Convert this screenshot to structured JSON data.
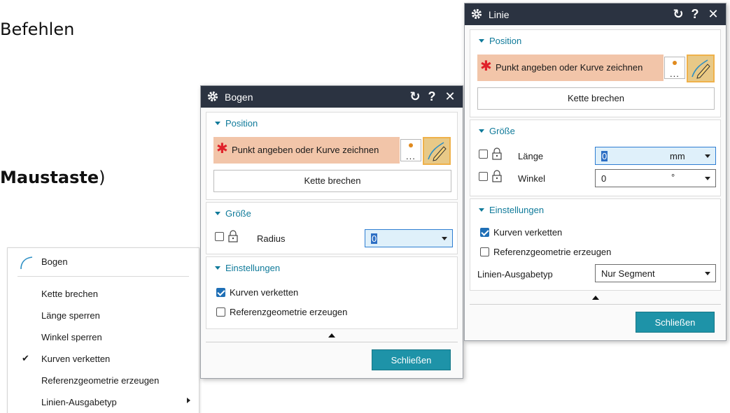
{
  "background": {
    "line1": "Befehlen",
    "line2_bold": "Maustaste",
    "line2_paren": ")"
  },
  "context_menu": {
    "header": "Bogen",
    "items": [
      {
        "label": "Kette brechen",
        "checked": false,
        "submenu": false
      },
      {
        "label": "Länge sperren",
        "checked": false,
        "submenu": false
      },
      {
        "label": "Winkel sperren",
        "checked": false,
        "submenu": false
      },
      {
        "label": "Kurven verketten",
        "checked": true,
        "submenu": false
      },
      {
        "label": "Referenzgeometrie erzeugen",
        "checked": false,
        "submenu": false
      },
      {
        "label": "Linien-Ausgabetyp",
        "checked": false,
        "submenu": true
      }
    ],
    "check_glyph": "✔"
  },
  "bogen": {
    "title": "Bogen",
    "position": {
      "header": "Position",
      "prompt": "Punkt angeben oder Kurve zeichnen",
      "dots": "...",
      "break_chain": "Kette brechen"
    },
    "size": {
      "header": "Größe",
      "radius_label": "Radius",
      "radius_value": "0"
    },
    "settings": {
      "header": "Einstellungen",
      "chain_curves": "Kurven verketten",
      "ref_geometry": "Referenzgeometrie erzeugen"
    },
    "close": "Schließen"
  },
  "linie": {
    "title": "Linie",
    "position": {
      "header": "Position",
      "prompt": "Punkt angeben oder Kurve zeichnen",
      "dots": "...",
      "break_chain": "Kette brechen"
    },
    "size": {
      "header": "Größe",
      "length_label": "Länge",
      "length_value": "0",
      "length_unit": "mm",
      "angle_label": "Winkel",
      "angle_value": "0",
      "angle_unit": "°"
    },
    "settings": {
      "header": "Einstellungen",
      "chain_curves": "Kurven verketten",
      "ref_geometry": "Referenzgeometrie erzeugen",
      "output_label": "Linien-Ausgabetyp",
      "output_value": "Nur Segment"
    },
    "close": "Schließen"
  },
  "titlebar_buttons": {
    "reset": "↻",
    "help": "?",
    "close": "✕"
  },
  "colors": {
    "titlebar": "#2b3341",
    "accent": "#0f7a9a",
    "selection_required": "#f2c5a9",
    "close_button": "#1e93a8",
    "required_star": "#e0222a"
  }
}
